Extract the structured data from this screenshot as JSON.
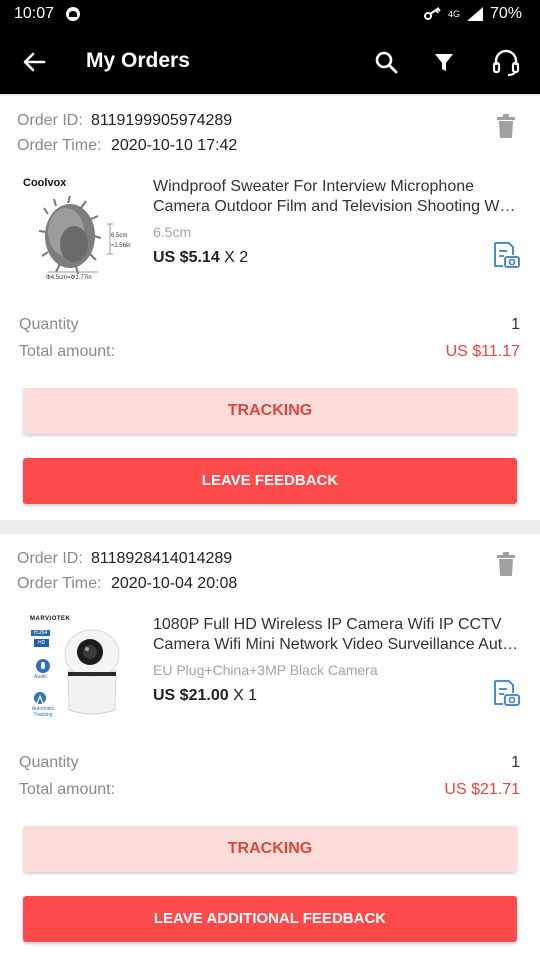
{
  "status_bar": {
    "time": "10:07",
    "network": "4G",
    "battery": "70%"
  },
  "header": {
    "title": "My Orders",
    "icons": [
      "back-arrow-icon",
      "search-icon",
      "filter-icon",
      "headset-icon"
    ]
  },
  "labels": {
    "order_id": "Order ID:",
    "order_time": "Order Time:",
    "quantity": "Quantity",
    "total_amount": "Total amount:",
    "tracking": "TRACKING"
  },
  "orders": [
    {
      "order_id": "8119199905974289",
      "order_time": "2020-10-10 17:42",
      "brand": "Coolvox",
      "title_line1": "Windproof Sweater For Interview Microphone",
      "title_line2": "Camera Outdoor Film and Television Shooting Windproof Fur",
      "variant": "6.5cm",
      "price": "US $5.14",
      "multiplier": "X 2",
      "quantity": "1",
      "total": "US $11.17",
      "feedback_label": "LEAVE FEEDBACK",
      "image_labels": {
        "height": "6.5cm",
        "height_in": "≈2.56in",
        "diameter": "Φ4.5cm=Φ1.77in"
      }
    },
    {
      "order_id": "8118928414014289",
      "order_time": "2020-10-04 20:08",
      "brand": "MARVIOTEK",
      "title_line1": "1080P Full HD Wireless IP Camera Wifi IP CCTV",
      "title_line2": "Camera Wifi Mini Network Video Surveillance Auto Tracking",
      "variant": "EU Plug+China+3MP Black Camera",
      "price": "US $21.00",
      "multiplier": "X 1",
      "quantity": "1",
      "total": "US $21.71",
      "feedback_label": "LEAVE ADDITIONAL FEEDBACK",
      "image_labels": {
        "codec": "H.264",
        "hd": "HD",
        "audio": "Audio",
        "tracking": "Automatic Tracking"
      }
    }
  ],
  "colors": {
    "accent": "#fe4a4a",
    "accent_light": "#fdddd9",
    "total_text": "#e64340",
    "icon_blue": "#3b7fc4"
  }
}
